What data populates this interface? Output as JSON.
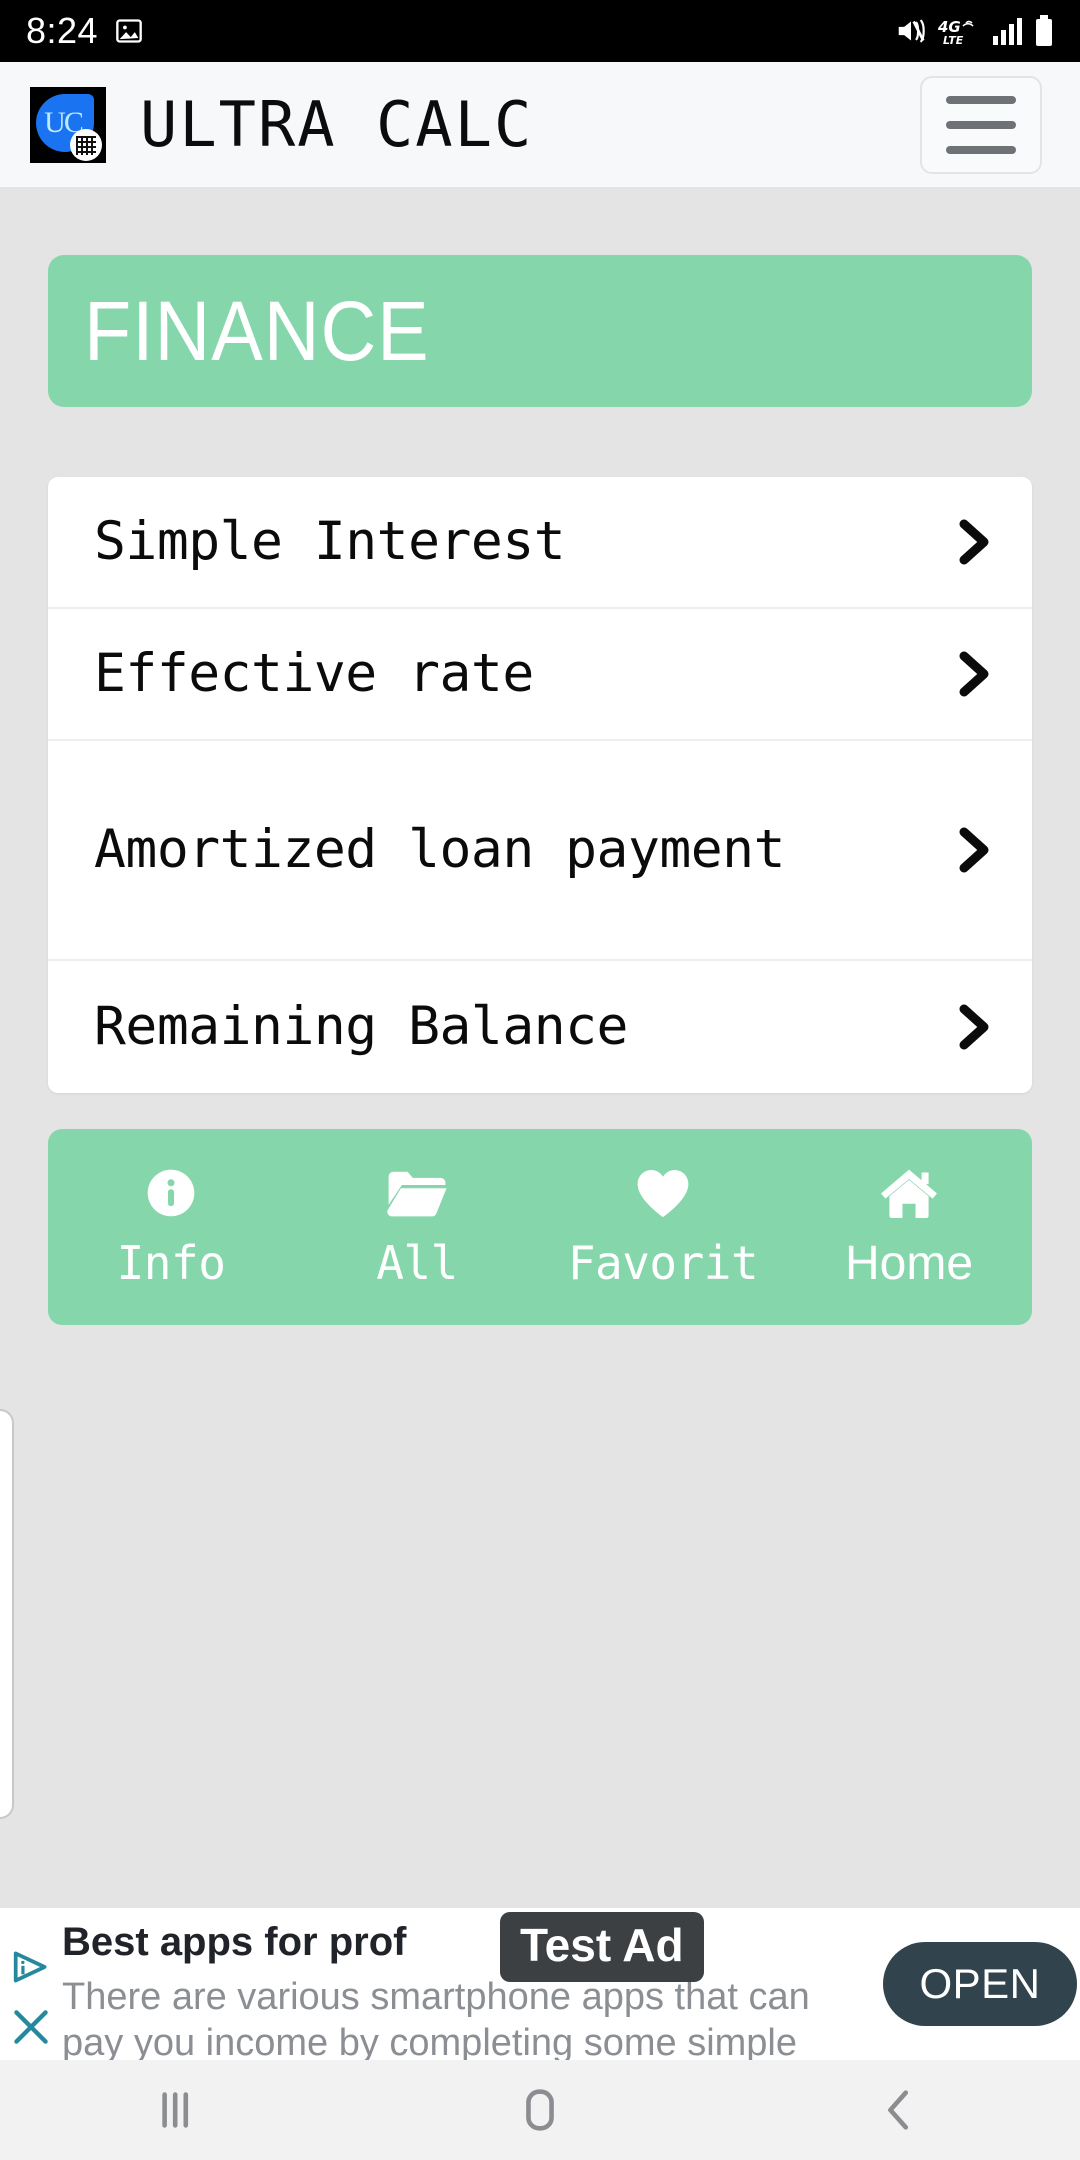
{
  "status_bar": {
    "time": "8:24",
    "icons": [
      "photo-icon",
      "mute-icon",
      "4g-lte-icon",
      "signal-bars-icon",
      "battery-icon"
    ],
    "network_label": "4G",
    "network_sub": "LTE"
  },
  "header": {
    "app_title": "ULTRA CALC",
    "logo_text": "UC",
    "menu_icon": "hamburger-menu-icon"
  },
  "banner": {
    "title": "FINANCE",
    "color": "#85d6ab"
  },
  "list": {
    "items": [
      {
        "label": "Simple Interest",
        "chevron": "chevron-right-icon"
      },
      {
        "label": "Effective rate",
        "chevron": "chevron-right-icon"
      },
      {
        "label": "Amortized loan payment",
        "chevron": "chevron-right-icon"
      },
      {
        "label": "Remaining Balance",
        "chevron": "chevron-right-icon"
      }
    ]
  },
  "tabbar": {
    "color": "#85d6ab",
    "tabs": [
      {
        "label": "Info",
        "icon": "info-circle-icon"
      },
      {
        "label": "All",
        "icon": "folder-open-icon"
      },
      {
        "label": "Favorit",
        "icon": "heart-icon"
      },
      {
        "label": "Home",
        "icon": "home-icon"
      }
    ]
  },
  "ad": {
    "badge": "Test Ad",
    "headline": "Best apps for prof",
    "description": "There are various smartphone apps that can pay you income by completing some simple",
    "cta_label": "OPEN",
    "adchoices_icon": "adchoices-icon",
    "close_icon": "close-x-icon"
  },
  "system_nav": {
    "recents_icon": "recents-icon",
    "home_icon": "home-square-icon",
    "back_icon": "back-chevron-icon"
  }
}
